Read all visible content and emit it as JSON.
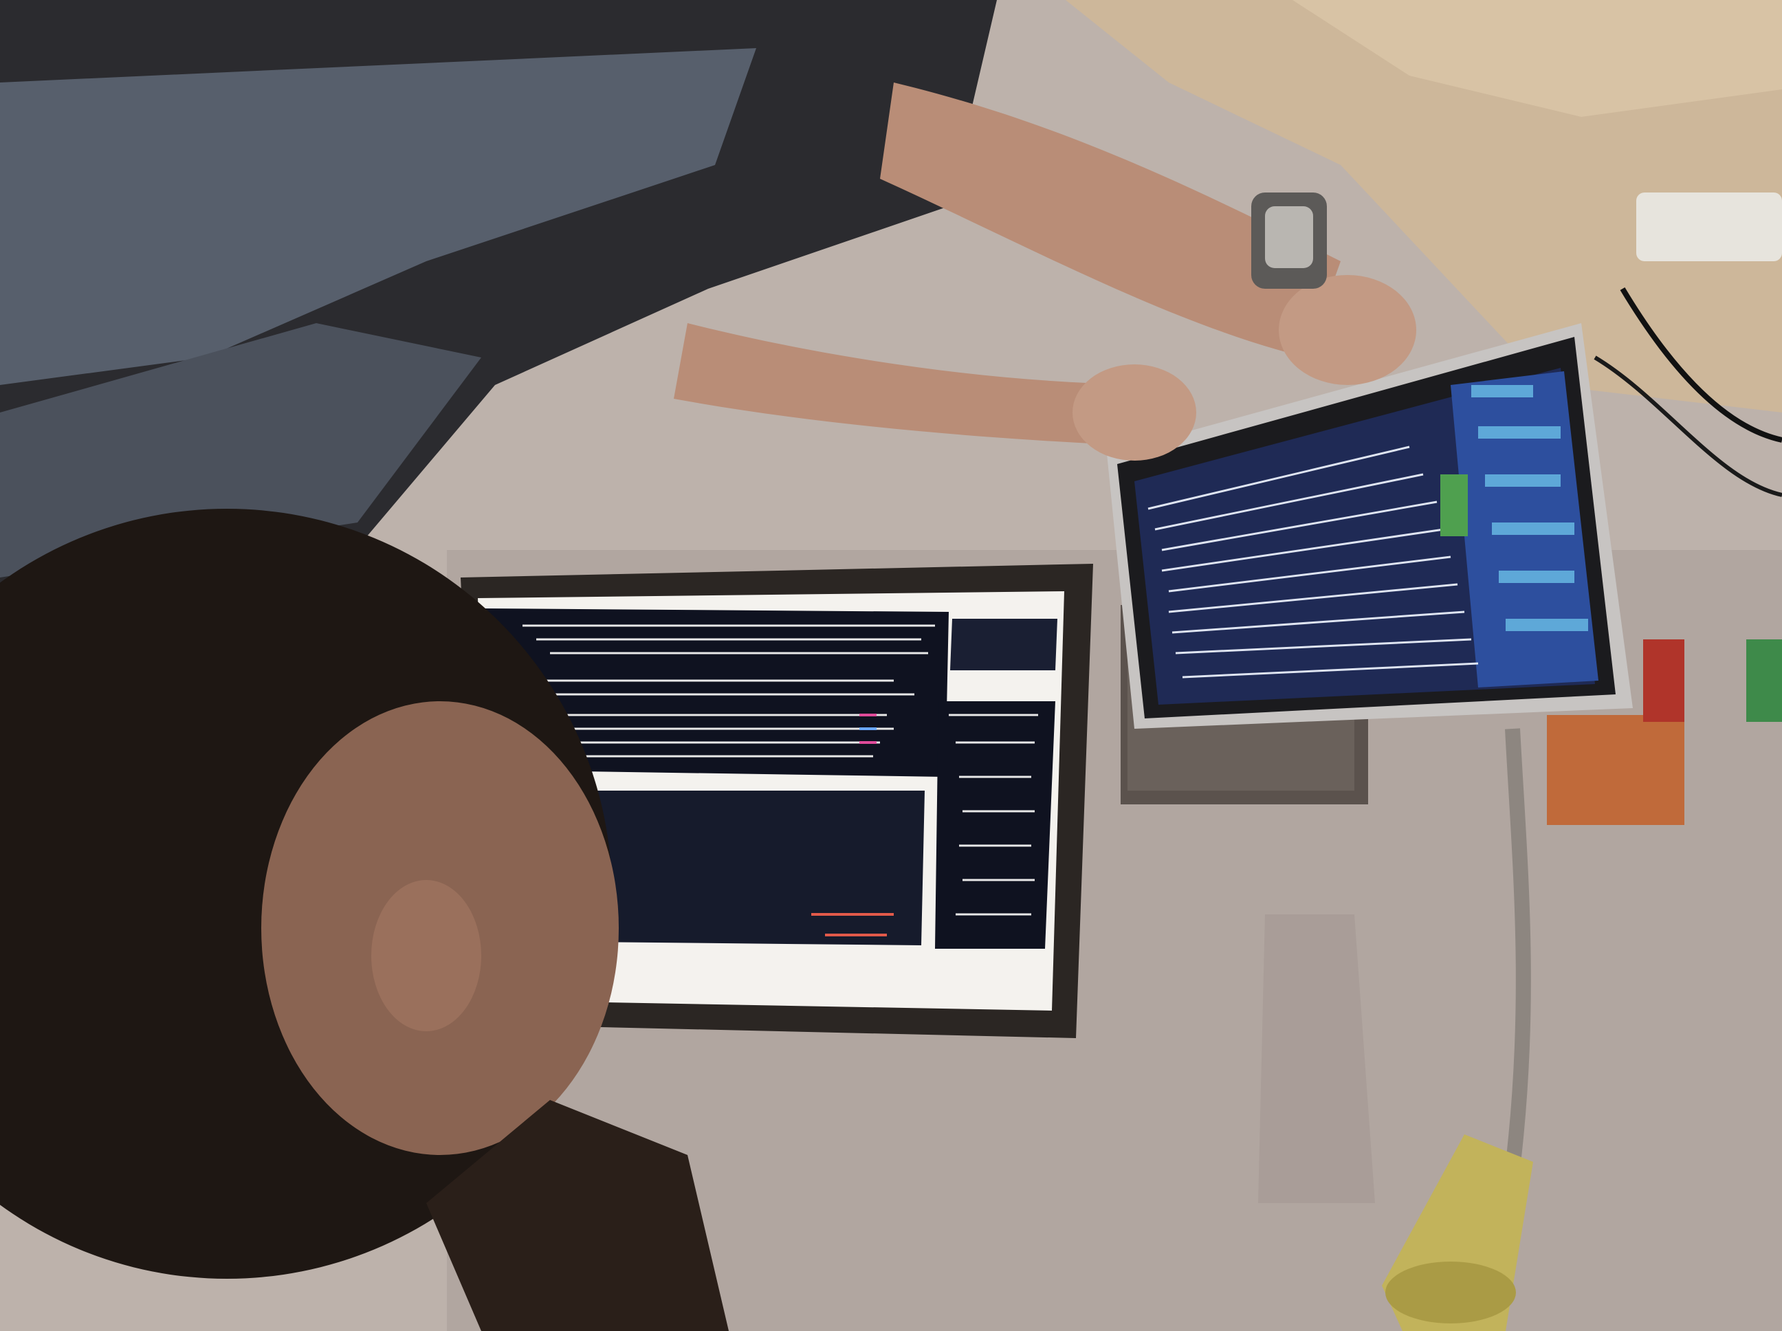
{
  "scene": {
    "description_visible_text": [],
    "colors": {
      "wall": "#bdb2ab",
      "wall_shadow": "#a79d97",
      "desk": "#cdb79a",
      "shirt_dark": "#2b2b2f",
      "shirt_stripe": "#575f6c",
      "skin": "#b98d77",
      "hair": "#1e1713",
      "screen_dark": "#0f1220",
      "screen_blue": "#2d4f9e",
      "screen_white": "#f4f2ee",
      "lamp_yellow": "#c2b35b",
      "lamp_arm": "#8d8680"
    }
  }
}
